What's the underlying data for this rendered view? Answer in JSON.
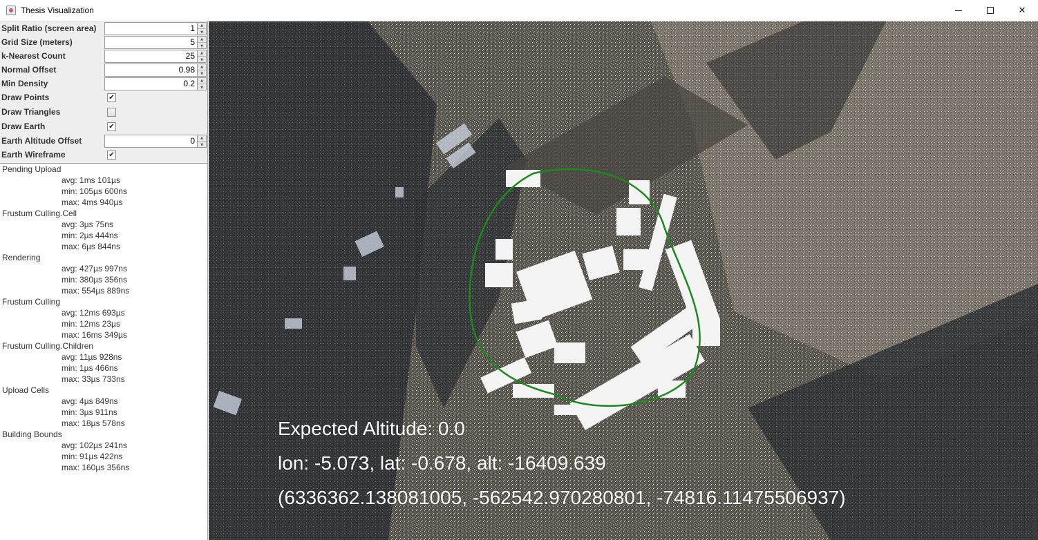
{
  "window": {
    "title": "Thesis Visualization",
    "minimize_icon": "minimize-icon",
    "maximize_icon": "maximize-icon",
    "close_icon": "close-icon",
    "close_glyph": "✕"
  },
  "settings": {
    "split_ratio": {
      "label": "Split Ratio (screen area)",
      "value": "1"
    },
    "grid_size": {
      "label": "Grid Size (meters)",
      "value": "5"
    },
    "k_nearest": {
      "label": "k-Nearest Count",
      "value": "25"
    },
    "normal_offset": {
      "label": "Normal Offset",
      "value": "0.98"
    },
    "min_density": {
      "label": "Min Density",
      "value": "0.2"
    },
    "draw_points": {
      "label": "Draw Points",
      "checked": true
    },
    "draw_triangles": {
      "label": "Draw Triangles",
      "checked": false
    },
    "draw_earth": {
      "label": "Draw Earth",
      "checked": true
    },
    "earth_altitude_offset": {
      "label": "Earth Altitude Offset",
      "value": "0"
    },
    "earth_wireframe": {
      "label": "Earth Wireframe",
      "checked": true
    }
  },
  "check_glyph": "✔",
  "stats": [
    {
      "name": "Pending Upload",
      "avg": "avg: 1ms 101µs",
      "min": "min: 105µs 600ns",
      "max": "max: 4ms 940µs"
    },
    {
      "name": "Frustum Culling.Cell",
      "avg": "avg: 3µs 75ns",
      "min": "min: 2µs 444ns",
      "max": "max: 6µs 844ns"
    },
    {
      "name": "Rendering",
      "avg": "avg: 427µs 997ns",
      "min": "min: 380µs 356ns",
      "max": "max: 554µs 889ns"
    },
    {
      "name": "Frustum Culling",
      "avg": "avg: 12ms 693µs",
      "min": "min: 12ms 23µs",
      "max": "max: 16ms 349µs"
    },
    {
      "name": "Frustum Culling.Children",
      "avg": "avg: 11µs 928ns",
      "min": "min: 1µs 466ns",
      "max": "max: 33µs 733ns"
    },
    {
      "name": "Upload Cells",
      "avg": "avg: 4µs 849ns",
      "min": "min: 3µs 911ns",
      "max": "max: 18µs 578ns"
    },
    {
      "name": "Building Bounds",
      "avg": "avg: 102µs 241ns",
      "min": "min: 91µs 422ns",
      "max": "max: 160µs 356ns"
    }
  ],
  "overlay": {
    "expected_altitude": "Expected Altitude: 0.0",
    "geo": "lon: -5.073, lat: -0.678, alt: -16409.639",
    "cartesian": "(6336362.138081005, -562542.970280801, -74816.11475506937)"
  },
  "colors": {
    "bounds_outline": "#1a8a1a",
    "building_points": "#f4f4f4"
  }
}
